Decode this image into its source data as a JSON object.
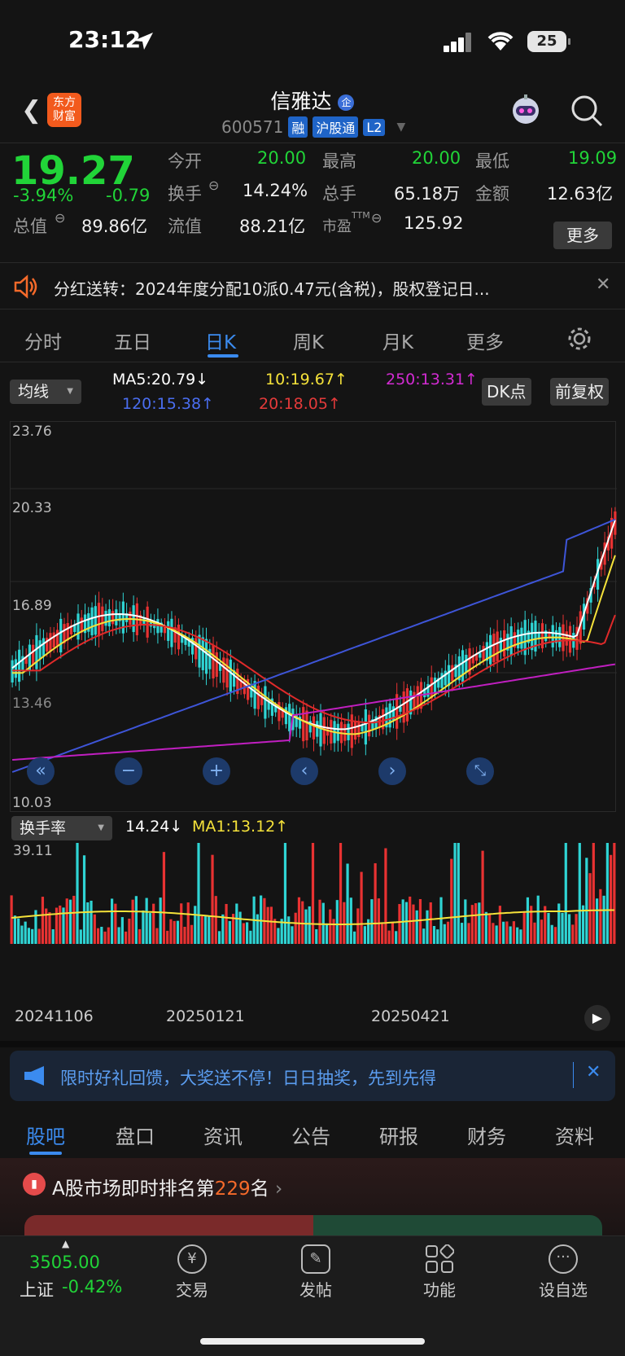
{
  "status": {
    "time": "23:12",
    "battery": "25"
  },
  "header": {
    "logo": "东方\n财富",
    "stock_name": "信雅达",
    "code": "600571",
    "tags": [
      "融",
      "沪股通",
      "L2"
    ]
  },
  "quote": {
    "price": "19.27",
    "change_pct": "-3.94%",
    "change": "-0.79",
    "open_label": "今开",
    "open": "20.00",
    "high_label": "最高",
    "high": "20.00",
    "low_label": "最低",
    "low": "19.09",
    "turnover_label": "换手",
    "turnover": "14.24%",
    "volume_label": "总手",
    "volume": "65.18万",
    "amount_label": "金额",
    "amount": "12.63亿",
    "mcap_label": "总值",
    "mcap": "89.86亿",
    "float_label": "流值",
    "float": "88.21亿",
    "pe_label": "市盈",
    "pe_sup": "TTM",
    "pe": "125.92",
    "more": "更多"
  },
  "notice": {
    "text": "分红送转：2024年度分配10派0.47元(含税)，股权登记日..."
  },
  "tabs": [
    "分时",
    "五日",
    "日K",
    "周K",
    "月K",
    "更多"
  ],
  "ma_legend": {
    "dropdown": "均线",
    "ma5": "MA5:20.79↓",
    "ma10": "10:19.67↑",
    "ma250": "250:13.31↑",
    "ma120": "120:15.38↑",
    "ma20": "20:18.05↑",
    "dk": "DK点",
    "adjust": "前复权",
    "colors": {
      "ma5": "#ffffff",
      "ma10": "#f5e23a",
      "ma20": "#e02a2a",
      "ma120": "#3e55d8",
      "ma250": "#c01fc0",
      "up": "#e83232",
      "down": "#2fd4d4"
    }
  },
  "kchart": {
    "y_labels": [
      "23.76",
      "20.33",
      "16.89",
      "13.46",
      "10.03"
    ]
  },
  "vol": {
    "dropdown": "换手率",
    "value": "14.24↓",
    "ma1": "MA1:13.12↑",
    "max_label": "39.11"
  },
  "dates": [
    "20241106",
    "20250121",
    "20250421"
  ],
  "promo": {
    "text": "限时好礼回馈，大奖送不停！日日抽奖，先到先得"
  },
  "bottom_tabs": [
    "股吧",
    "盘口",
    "资讯",
    "公告",
    "研报",
    "财务",
    "资料"
  ],
  "rank": {
    "prefix": "A股市场即时排名第",
    "num": "229",
    "suffix": "名"
  },
  "dock": {
    "index_value": "3505.00",
    "index_name": "上证",
    "index_change": "-0.42%",
    "items": [
      "交易",
      "发帖",
      "功能",
      "设自选"
    ]
  }
}
